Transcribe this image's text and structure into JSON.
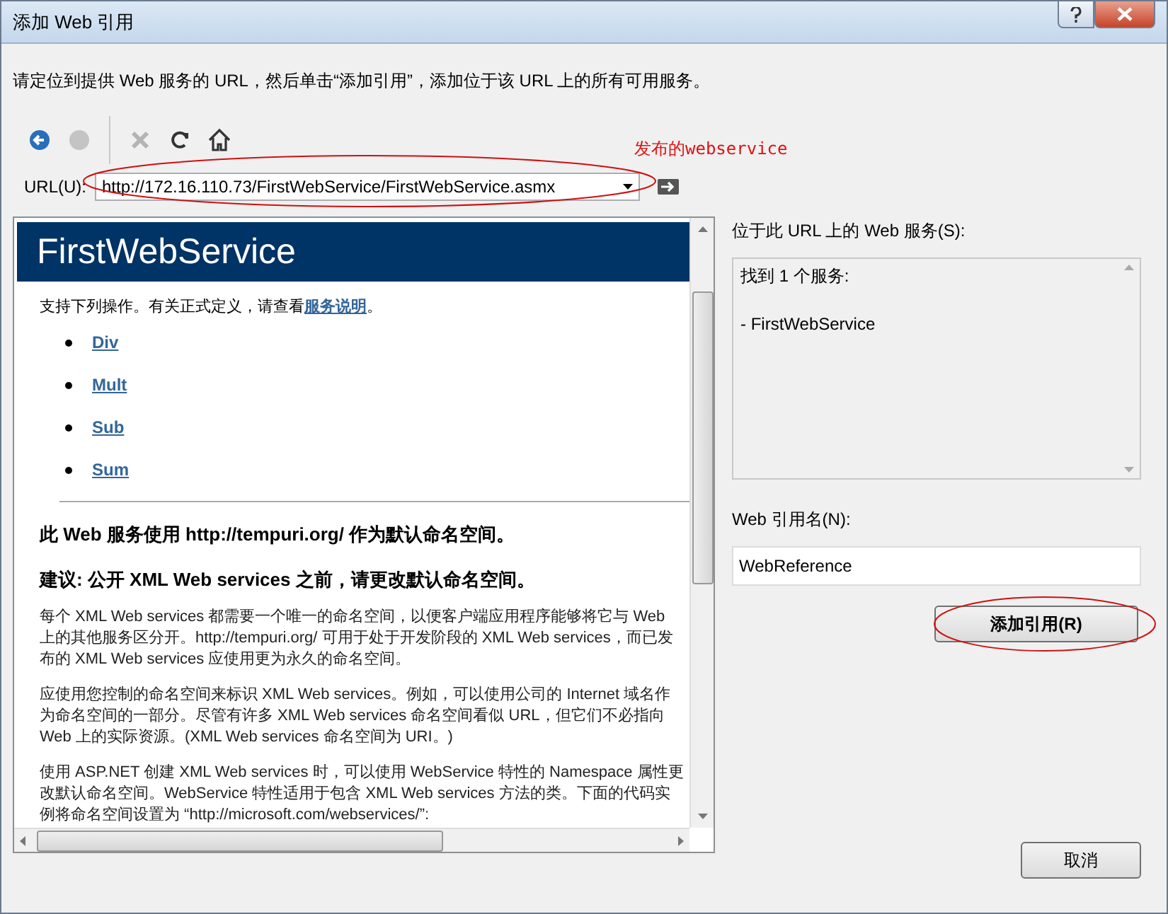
{
  "window": {
    "title": "添加 Web 引用"
  },
  "instruction": "请定位到提供 Web 服务的 URL，然后单击“添加引用”，添加位于该 URL 上的所有可用服务。",
  "toolbar": [
    {
      "kind": "back",
      "disabled": false
    },
    {
      "kind": "stop",
      "disabled": true
    },
    {
      "kind": "cancel",
      "disabled": true
    },
    {
      "kind": "refresh",
      "disabled": false
    },
    {
      "kind": "home",
      "disabled": false
    }
  ],
  "annotation": {
    "text": "发布的webservice"
  },
  "url": {
    "label": "URL(U):",
    "value": "http://172.16.110.73/FirstWebService/FirstWebService.asmx"
  },
  "browser": {
    "title": "FirstWebService",
    "intro": "支持下列操作。有关正式定义，请查看",
    "intro_link": "服务说明",
    "intro_end": "。",
    "operations": [
      "Div",
      "Mult",
      "Sub",
      "Sum"
    ],
    "headings": [
      "此 Web 服务使用 http://tempuri.org/ 作为默认命名空间。",
      "建议: 公开 XML Web services 之前，请更改默认命名空间。"
    ],
    "paragraphs": [
      "每个 XML Web services 都需要一个唯一的命名空间，以便客户端应用程序能够将它与 Web 上的其他服务区分开。http://tempuri.org/ 可用于处于开发阶段的 XML Web services，而已发布的 XML Web services 应使用更为永久的命名空间。",
      "应使用您控制的命名空间来标识 XML Web services。例如，可以使用公司的 Internet 域名作为命名空间的一部分。尽管有许多 XML Web services 命名空间看似 URL，但它们不必指向 Web 上的实际资源。(XML Web services 命名空间为 URI。)",
      "使用 ASP.NET 创建 XML Web services 时，可以使用 WebService 特性的 Namespace 属性更改默认命名空间。WebService 特性适用于包含 XML Web services 方法的类。下面的代码实例将命名空间设置为 “http://microsoft.com/webservices/”:"
    ]
  },
  "services": {
    "label": "位于此 URL 上的 Web 服务(S):",
    "lines": [
      "找到 1 个服务:",
      "- FirstWebService"
    ]
  },
  "reference_name": {
    "label": "Web 引用名(N):",
    "value": "WebReference"
  },
  "buttons": {
    "add": "添加引用(R)",
    "cancel": "取消"
  }
}
